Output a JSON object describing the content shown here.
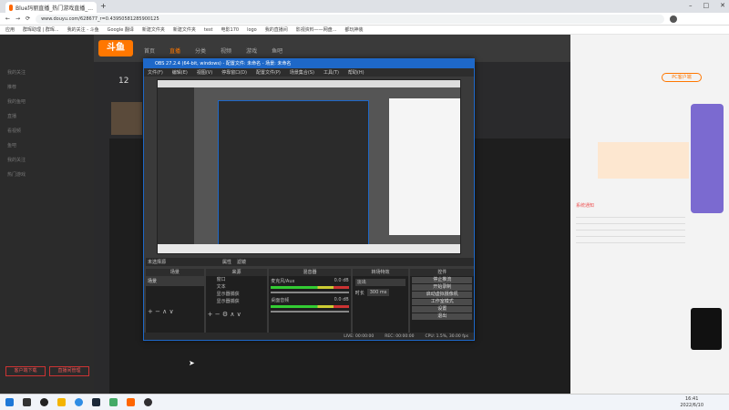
{
  "browser": {
    "tab_title": "Blue玛丽直播_热门游戏直播_...",
    "url": "www.douyu.com/628677_r=0.43950581285900125",
    "bookmarks": [
      "应用",
      "群晖助理 | 群晖...",
      "我的关注 - 斗鱼",
      "Google 翻译",
      "新建文件夹",
      "新建文件夹",
      "test",
      "电影170",
      "logo",
      "我的直播间",
      "影视资料——网盘...",
      "都玩神装"
    ]
  },
  "douyu": {
    "logo": "斗鱼",
    "nav": [
      "首页",
      "直播",
      "分类",
      "视频",
      "游戏",
      "鱼吧"
    ],
    "left_nav": [
      "我的关注",
      "推荐",
      "我的鱼吧",
      "直播",
      "看视频",
      "鱼吧",
      "我的关注",
      "热门游戏"
    ],
    "count": "12",
    "bottom_buttons": [
      "客户端下载",
      "直播间管理"
    ],
    "right_badge": "PC客户端",
    "notice_label": "系统通知"
  },
  "obs": {
    "title": "OBS 27.2.4 (64-bit, windows) - 配置文件: 未命名 - 场景: 未命名",
    "menu": [
      "文件(F)",
      "编辑(E)",
      "视图(V)",
      "停靠窗口(D)",
      "配置文件(P)",
      "场景集合(S)",
      "工具(T)",
      "帮助(H)"
    ],
    "source_label": "未选择源",
    "properties": "属性",
    "filters": "滤镜",
    "docks": [
      "场景",
      "来源",
      "混音器",
      "转场特效",
      "控件"
    ],
    "scene_item": "场景",
    "sources": [
      "窗口",
      "文本",
      "显示器捕获",
      "显示器捕获"
    ],
    "mixer": [
      {
        "name": "麦克风/Aux",
        "db": "0.0 dB"
      },
      {
        "name": "桌面音频",
        "db": "0.0 dB"
      }
    ],
    "transition": {
      "type": "淡出",
      "duration_label": "时长",
      "duration": "300 ms"
    },
    "controls": [
      "停止推流",
      "开始录制",
      "启动虚拟摄像机",
      "工作室模式",
      "设置",
      "退出"
    ],
    "status": {
      "live": "LIVE: 00:00:00",
      "rec": "REC: 00:00:00",
      "cpu": "CPU: 1.5%, 30.00 fps"
    }
  },
  "taskbar": {
    "time": "16:41",
    "date": "2022/6/10"
  }
}
